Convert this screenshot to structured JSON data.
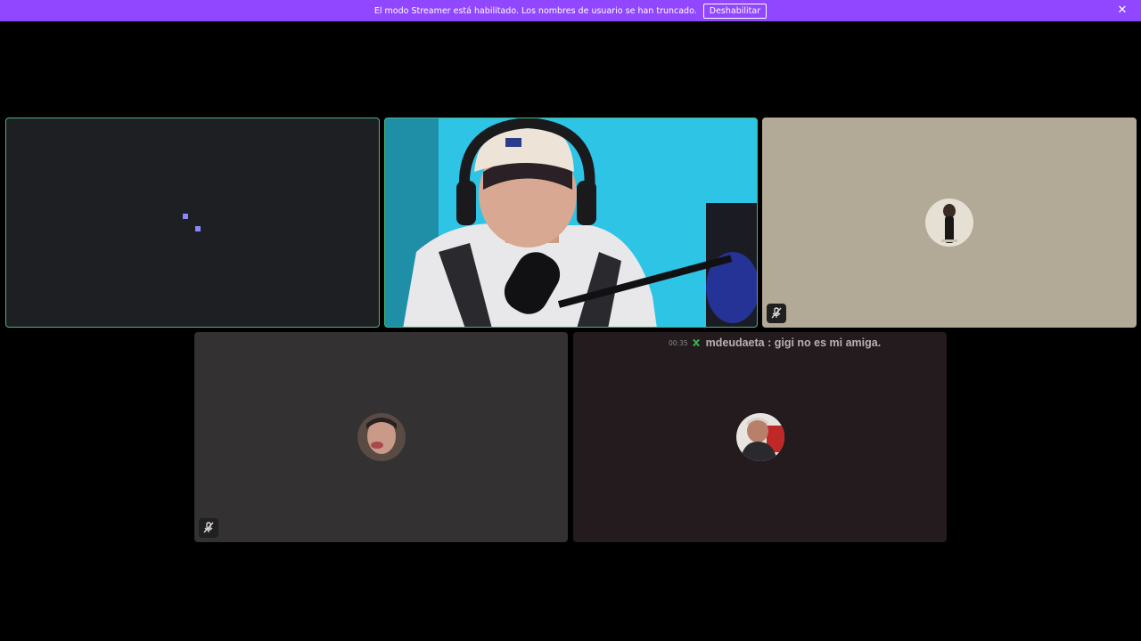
{
  "banner": {
    "message": "El modo Streamer está habilitado. Los nombres de usuario se han truncado.",
    "button_label": "Deshabilitar",
    "close_icon": "close-icon",
    "background": "#9146ff"
  },
  "tiles": [
    {
      "name": "participant-1",
      "state": "speaking",
      "icon": "pixel-dots"
    },
    {
      "name": "participant-2",
      "state": "speaking",
      "content": "camera-video"
    },
    {
      "name": "participant-3",
      "muted": true,
      "icon": "mute-icon"
    },
    {
      "name": "participant-4",
      "muted": true,
      "icon": "mute-icon"
    },
    {
      "name": "participant-5",
      "chat_overlay": true
    }
  ],
  "chat": {
    "time": "00:35",
    "message": "mdeudaeta : gigi no es mi amiga.",
    "badge_icon": "verified-badge-icon"
  },
  "colors": {
    "speaking_border": "#43b581",
    "accent": "#9146ff"
  }
}
